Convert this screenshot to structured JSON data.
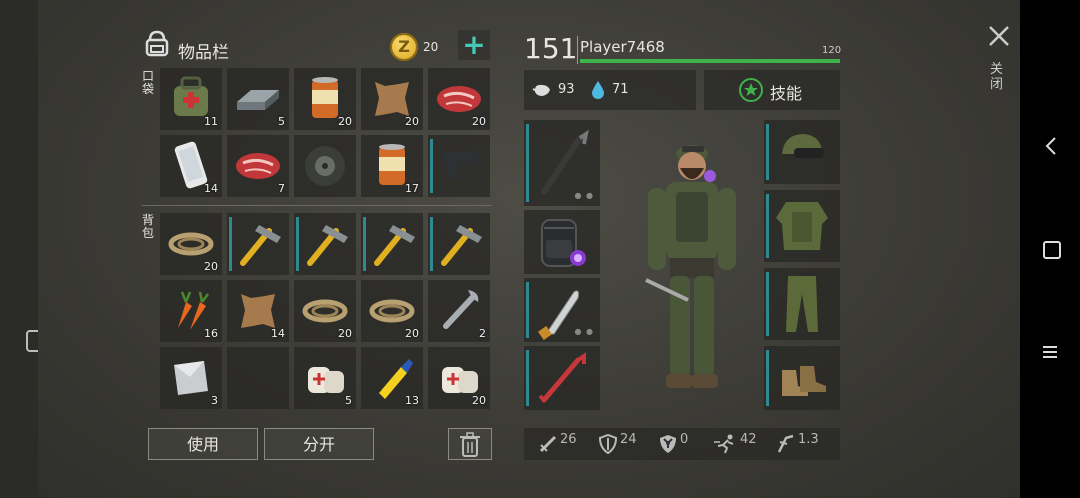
{
  "header": {
    "inventory_title": "物品栏",
    "coins": "20",
    "add_label": "+"
  },
  "sections": {
    "pockets": "口袋",
    "backpack": "背包"
  },
  "slots": [
    {
      "icon": "medkit-bag-icon",
      "count": "11"
    },
    {
      "icon": "iron-bar-icon",
      "count": "5"
    },
    {
      "icon": "food-can-icon",
      "count": "20"
    },
    {
      "icon": "leather-hide-icon",
      "count": "20"
    },
    {
      "icon": "raw-steak-icon",
      "count": "20"
    },
    {
      "icon": "smartphone-icon",
      "count": "14"
    },
    {
      "icon": "raw-steak-icon",
      "count": "7"
    },
    {
      "icon": "tire-wheel-icon",
      "count": ""
    },
    {
      "icon": "food-can-icon",
      "count": "17"
    },
    {
      "icon": "pistol-icon",
      "count": ""
    },
    {
      "icon": "rope-icon",
      "count": "20"
    },
    {
      "icon": "hammer-icon",
      "count": ""
    },
    {
      "icon": "hammer-icon",
      "count": ""
    },
    {
      "icon": "hammer-icon",
      "count": ""
    },
    {
      "icon": "hammer-icon",
      "count": ""
    },
    {
      "icon": "carrot-icon",
      "count": "16"
    },
    {
      "icon": "leather-hide-icon",
      "count": "14"
    },
    {
      "icon": "rope-icon",
      "count": "20"
    },
    {
      "icon": "rope-icon",
      "count": "20"
    },
    {
      "icon": "wrench-icon",
      "count": "2"
    },
    {
      "icon": "metal-sheet-icon",
      "count": "3"
    },
    {
      "icon": "",
      "count": ""
    },
    {
      "icon": "bandage-icon",
      "count": "5"
    },
    {
      "icon": "glue-icon",
      "count": "13"
    },
    {
      "icon": "bandage-icon",
      "count": "20"
    }
  ],
  "actions": {
    "use": "使用",
    "split": "分开"
  },
  "player": {
    "level": "151",
    "name": "Player7468",
    "xp_value": "120",
    "xp_fraction": 1.0,
    "hunger": "93",
    "thirst": "71",
    "skills_label": "技能"
  },
  "equipment": {
    "left": [
      {
        "icon": "crowbar-icon"
      },
      {
        "icon": "backpack-icon"
      },
      {
        "icon": "machete-icon"
      },
      {
        "icon": "crowbar-red-icon"
      }
    ],
    "right": [
      {
        "icon": "helmet-goggles-icon"
      },
      {
        "icon": "camo-jacket-icon"
      },
      {
        "icon": "camo-pants-icon"
      },
      {
        "icon": "boots-icon"
      }
    ]
  },
  "stats": {
    "attack": "26",
    "defense": "24",
    "radiation": "0",
    "speed": "42",
    "stealth": "1.3"
  },
  "close_label": "关闭",
  "colors": {
    "xp_bar": "#3db34a",
    "durability": "#2e8a8f",
    "coin": "#e8b82a",
    "accent_green": "#3db34a"
  }
}
